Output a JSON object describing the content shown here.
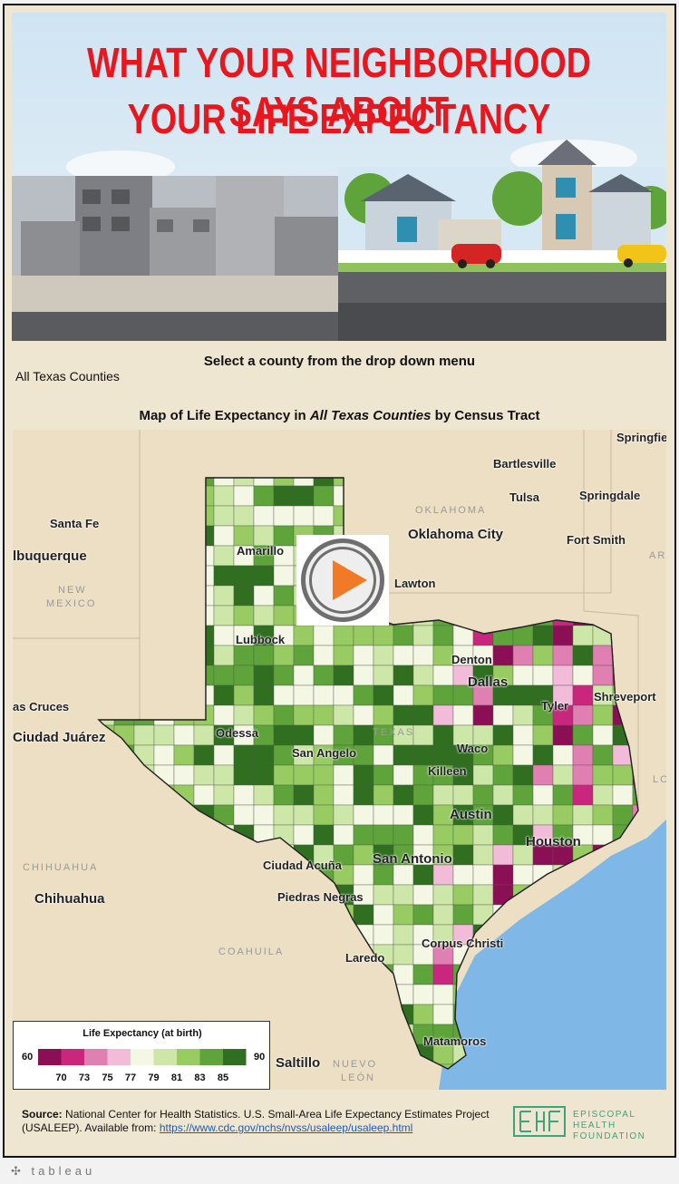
{
  "header": {
    "title_line1": "WHAT YOUR NEIGHBORHOOD SAYS ABOUT",
    "title_line2": "YOUR LIFE EXPECTANCY"
  },
  "controls": {
    "prompt": "Select a county from the drop down menu",
    "county_value": "All Texas Counties"
  },
  "map": {
    "title_pre": "Map of Life Expectancy in ",
    "title_county": "All Texas Counties",
    "title_post": " by Census Tract",
    "places": {
      "springfield": "Springfie",
      "bartlesville": "Bartlesville",
      "tulsa": "Tulsa",
      "springdale": "Springdale",
      "santa_fe": "Santa Fe",
      "oklahoma_city": "Oklahoma City",
      "albuquerque": "lbuquerque",
      "fort_smith": "Fort Smith",
      "amarillo": "Amarillo",
      "lawton": "Lawton",
      "lubbock": "Lubbock",
      "denton": "Denton",
      "dallas": "Dallas",
      "tyler": "Tyler",
      "shreveport": "Shreveport",
      "las_cruces": "as Cruces",
      "odessa": "Odessa",
      "ciudad_juarez": "Ciudad Juárez",
      "waco": "Waco",
      "san_angelo": "San Angelo",
      "killeen": "Killeen",
      "austin": "Austin",
      "houston": "Houston",
      "ciudad_acuna": "Ciudad Acuña",
      "san_antonio": "San Antonio",
      "chihuahua": "Chihuahua",
      "piedras_negras": "Piedras Negras",
      "corpus_christi": "Corpus Christi",
      "laredo": "Laredo",
      "matamoros": "Matamoros",
      "saltillo": "Saltillo"
    },
    "regions": {
      "oklahoma": "OKLAHOMA",
      "new_mexico_1": "NEW",
      "new_mexico_2": "MEXICO",
      "texas": "TEXAS",
      "chihuahua": "CHIHUAHUA",
      "coahuila": "COAHUILA",
      "nuevo_leon_1": "NUEVO",
      "nuevo_leon_2": "LEÓN",
      "arkansas_partial": "AR",
      "louisiana_partial": "LO"
    }
  },
  "chart_data": {
    "type": "heatmap",
    "title": "Map of Life Expectancy in All Texas Counties by Census Tract",
    "legend": {
      "title": "Life Expectancy (at birth)",
      "min": 60,
      "max": 90,
      "tick_labels": [
        "70",
        "73",
        "75",
        "77",
        "79",
        "81",
        "83",
        "85"
      ],
      "bin_colors": [
        "#8a0f55",
        "#c8277d",
        "#e07fb1",
        "#f2bcd9",
        "#f4f7e4",
        "#cde7a8",
        "#98cc62",
        "#5fa43a",
        "#2f6f1f"
      ]
    },
    "regions_shown": "Texas census tracts"
  },
  "source": {
    "label": "Source:",
    "text": " National Center for Health Statistics. U.S. Small-Area Life Expectancy Estimates Project (USALEEP). Available from: ",
    "url": "https://www.cdc.gov/nchs/nvss/usaleep/usaleep.html"
  },
  "logo": {
    "line1": "EPISCOPAL HEALTH",
    "line2": "FOUNDATION"
  },
  "footer": {
    "brand": "tableau"
  }
}
